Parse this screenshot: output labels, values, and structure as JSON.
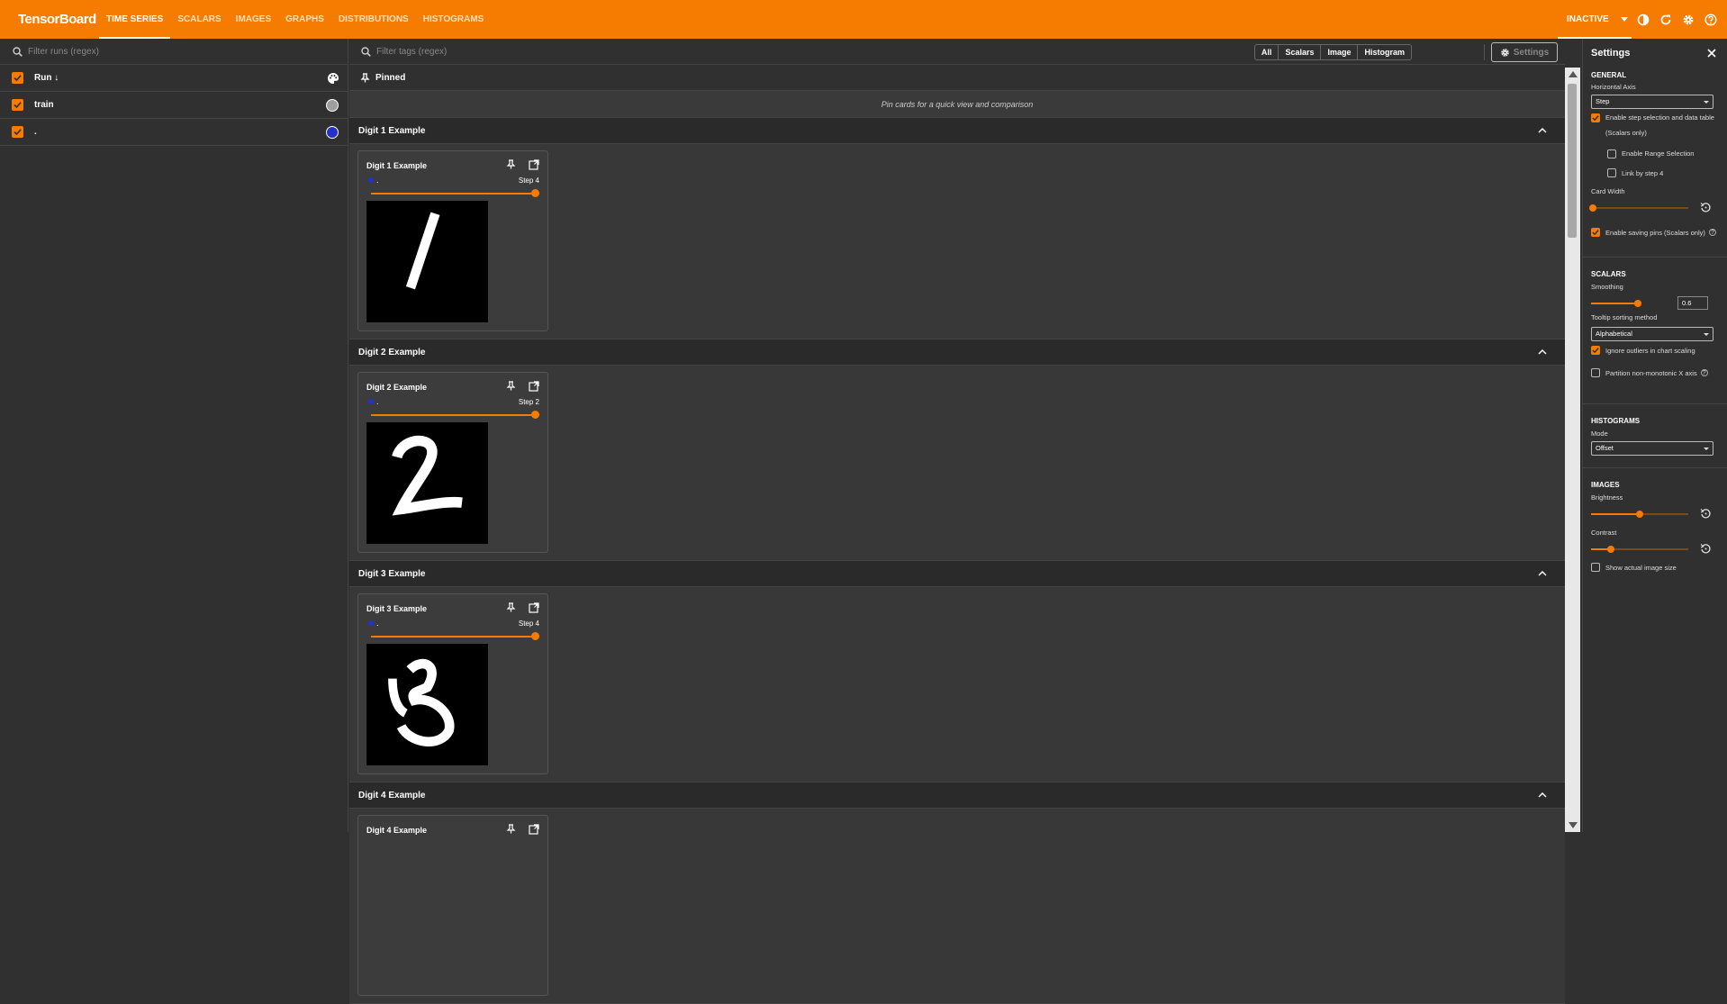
{
  "app": {
    "title": "TensorBoard"
  },
  "nav": {
    "tabs": [
      "TIME SERIES",
      "SCALARS",
      "IMAGES",
      "GRAPHS",
      "DISTRIBUTIONS",
      "HISTOGRAMS"
    ],
    "active": "TIME SERIES",
    "status": "INACTIVE"
  },
  "runs": {
    "filter_placeholder": "Filter runs (regex)",
    "header": "Run",
    "items": [
      {
        "label": "train",
        "color": "#9e9e9e"
      },
      {
        "label": ".",
        "color": "#2233cc"
      }
    ]
  },
  "main": {
    "filter_placeholder": "Filter tags (regex)",
    "types": [
      "All",
      "Scalars",
      "Image",
      "Histogram"
    ],
    "settings_button": "Settings",
    "pinned_label": "Pinned",
    "pinned_message": "Pin cards for a quick view and comparison",
    "groups": [
      {
        "title": "Digit 1 Example",
        "card": {
          "title": "Digit 1 Example",
          "run": ".",
          "step": "Step 4",
          "image": "handwritten-digit-1"
        }
      },
      {
        "title": "Digit 2 Example",
        "card": {
          "title": "Digit 2 Example",
          "run": ".",
          "step": "Step 2",
          "image": "handwritten-digit-2"
        }
      },
      {
        "title": "Digit 3 Example",
        "card": {
          "title": "Digit 3 Example",
          "run": ".",
          "step": "Step 4",
          "image": "handwritten-digit-3"
        }
      },
      {
        "title": "Digit 4 Example",
        "card": {
          "title": "Digit 4 Example"
        }
      }
    ]
  },
  "settings": {
    "title": "Settings",
    "general": {
      "heading": "GENERAL",
      "horizontal_axis_label": "Horizontal Axis",
      "horizontal_axis_value": "Step",
      "step_selection_label": "Enable step selection and data table",
      "step_selection_note": "(Scalars only)",
      "step_selection_checked": true,
      "range_selection_label": "Enable Range Selection",
      "range_selection_checked": false,
      "link_by_step_label": "Link by step 4",
      "link_by_step_checked": false,
      "card_width_label": "Card Width",
      "card_width_level": 0,
      "saving_pins_label": "Enable saving pins (Scalars only)",
      "saving_pins_checked": true
    },
    "scalars": {
      "heading": "SCALARS",
      "smoothing_label": "Smoothing",
      "smoothing_value": "0.6",
      "tooltip_label": "Tooltip sorting method",
      "tooltip_value": "Alphabetical",
      "ignore_outliers_label": "Ignore outliers in chart scaling",
      "ignore_outliers_checked": true,
      "partition_label": "Partition non-monotonic X axis",
      "partition_checked": false
    },
    "histograms": {
      "heading": "HISTOGRAMS",
      "mode_label": "Mode",
      "mode_value": "Offset"
    },
    "images": {
      "heading": "IMAGES",
      "brightness_label": "Brightness",
      "brightness_level": 0.5,
      "contrast_label": "Contrast",
      "contrast_level": 0.2,
      "actual_size_label": "Show actual image size",
      "actual_size_checked": false
    }
  },
  "colors": {
    "accent": "#f57c00",
    "background": "#303030"
  }
}
